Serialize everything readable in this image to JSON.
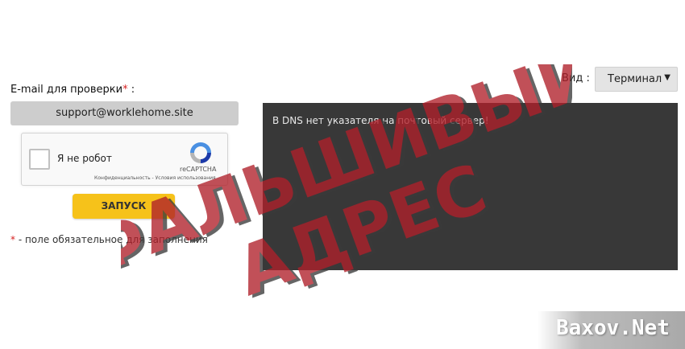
{
  "form": {
    "email_label": "E-mail для проверки",
    "required_mark": "*",
    "label_colon": " :",
    "email_value": "support@worklehome.site",
    "captcha": {
      "checkbox_label": "Я не робот",
      "brand": "reCAPTCHA",
      "links": "Конфиденциальность - Условия использования"
    },
    "start_button": "ЗАПУСК",
    "required_note": " - поле обязательное для заполнения"
  },
  "view": {
    "label": "Вид :",
    "selected": "Терминал"
  },
  "terminal": {
    "message": "В DNS нет указателя на почтовый сервер!"
  },
  "stamp": {
    "line1": "ФАЛЬШИВЫЙ",
    "line2": "АДРЕС",
    "color": "#b0202a"
  },
  "watermark": "Baxov.Net"
}
